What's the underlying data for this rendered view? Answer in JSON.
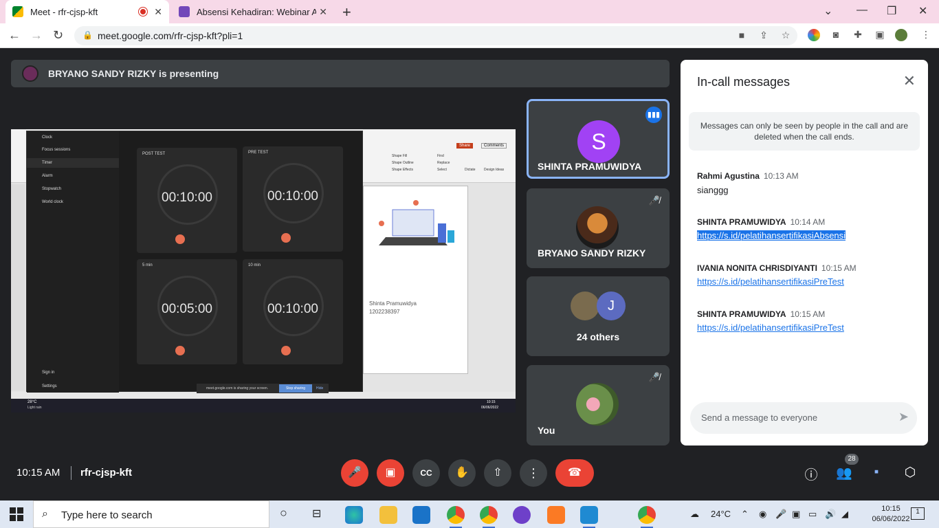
{
  "browser": {
    "tabs": [
      {
        "title": "Meet - rfr-cjsp-kft",
        "active": true
      },
      {
        "title": "Absensi Kehadiran: Webinar Adm",
        "active": false
      }
    ],
    "url": "meet.google.com/rfr-cjsp-kft?pli=1"
  },
  "presenter": {
    "text": "BRYANO SANDY RIZKY is presenting"
  },
  "shared_screen": {
    "clock_nav": [
      "Clock",
      "Focus sessions",
      "Timer",
      "Alarm",
      "Stopwatch",
      "World clock"
    ],
    "clock_nav_bottom": [
      "Sign in",
      "Settings"
    ],
    "timers": [
      {
        "label": "POST TEST",
        "time": "00:10:00"
      },
      {
        "label": "PRE TEST",
        "time": "00:10:00"
      },
      {
        "label": "5 min",
        "time": "00:05:00"
      },
      {
        "label": "10 min",
        "time": "00:10:00"
      }
    ],
    "slide_name": "Shinta Pramuwidya",
    "slide_id": "1202238397",
    "share_notice": "meet.google.com is sharing your screen.",
    "stop_sharing": "Stop sharing",
    "hide": "Hide",
    "ribbon_labels": [
      "Share",
      "Comments",
      "Find",
      "Replace",
      "Select",
      "Dictate",
      "Design Ideas",
      "Shape Fill",
      "Shape Outline",
      "Shape Effects"
    ],
    "taskbar_time": "10:15",
    "taskbar_date": "06/06/2022",
    "weather": "28°C",
    "weather_sub": "Light rain"
  },
  "participants": [
    {
      "name": "SHINTA PRAMUWIDYA",
      "initial": "S",
      "color": "#a142f4",
      "speaking": true
    },
    {
      "name": "BRYANO SANDY RIZKY",
      "muted": true
    },
    {
      "name": "24 others",
      "initial": "J",
      "color": "#5c6bc0"
    },
    {
      "name": "You",
      "muted": true
    }
  ],
  "chat": {
    "title": "In-call messages",
    "notice": "Messages can only be seen by people in the call and are deleted when the call ends.",
    "messages": [
      {
        "sender": "Rahmi Agustina",
        "time": "10:13 AM",
        "body": "sianggg"
      },
      {
        "sender": "SHINTA PRAMUWIDYA",
        "time": "10:14 AM",
        "link": "https://s.id/pelatihansertifikasiAbsensi"
      },
      {
        "sender": "IVANIA NONITA CHRISDIYANTI",
        "time": "10:15 AM",
        "link": "https://s.id/pelatihansertifikasiPreTest"
      },
      {
        "sender": "SHINTA PRAMUWIDYA",
        "time": "10:15 AM",
        "link": "https://s.id/pelatihansertifikasiPreTest"
      }
    ],
    "placeholder": "Send a message to everyone"
  },
  "bottom": {
    "time": "10:15 AM",
    "meeting_code": "rfr-cjsp-kft",
    "people_count": "28"
  },
  "taskbar": {
    "search_placeholder": "Type here to search",
    "temperature": "24°C",
    "time": "10:15",
    "date": "06/06/2022",
    "notifications": "1"
  }
}
